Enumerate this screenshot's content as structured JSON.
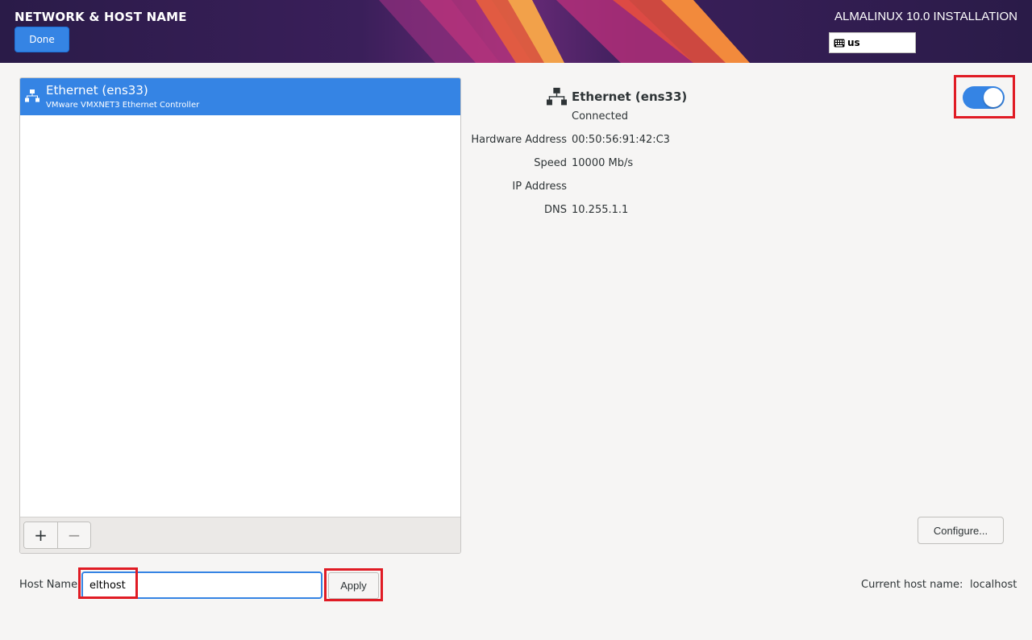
{
  "header": {
    "page_title": "NETWORK & HOST NAME",
    "done_label": "Done",
    "install_title": "ALMALINUX 10.0 INSTALLATION",
    "keyboard_layout": "us",
    "keyboard_icon": "keyboard-icon"
  },
  "device_list": {
    "items": [
      {
        "name": "Ethernet (ens33)",
        "description": "VMware VMXNET3 Ethernet Controller",
        "icon": "network-wired-icon",
        "selected": true
      }
    ],
    "add_label": "+",
    "remove_label": "−"
  },
  "details": {
    "device_name": "Ethernet (ens33)",
    "status": "Connected",
    "properties": [
      {
        "label": "Hardware Address",
        "value": "00:50:56:91:42:C3"
      },
      {
        "label": "Speed",
        "value": "10000 Mb/s"
      },
      {
        "label": "IP Address",
        "value": ""
      },
      {
        "label": "DNS",
        "value": "10.255.1.1"
      }
    ],
    "toggle_on": true,
    "configure_label": "Configure..."
  },
  "hostname": {
    "label": "Host Name:",
    "value": "elthost",
    "apply_label": "Apply",
    "current_label": "Current host name:",
    "current_value": "localhost"
  },
  "colors": {
    "accent": "#3584e4",
    "highlight_outline": "#e01b24",
    "header_bg": "#2b1a4a"
  }
}
